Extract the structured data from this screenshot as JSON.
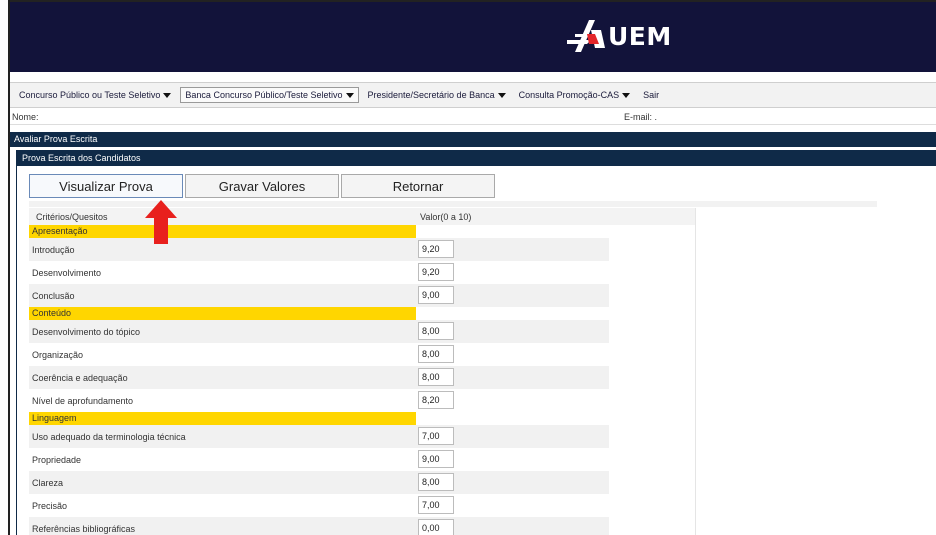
{
  "header": {
    "logo_text": "UEM",
    "logo_icon": "uem-flame-icon",
    "accent": "#e3262a",
    "bg": "#12133a"
  },
  "menu": {
    "items": [
      {
        "label": "Concurso Público ou Teste Seletivo",
        "has_caret": true
      },
      {
        "label": "Banca Concurso Público/Teste Seletivo",
        "has_caret": true
      },
      {
        "label": "Presidente/Secretário de Banca",
        "has_caret": true
      },
      {
        "label": "Consulta Promoção-CAS",
        "has_caret": true
      },
      {
        "label": "Sair",
        "has_caret": false
      }
    ]
  },
  "info": {
    "nome_label": "Nome:",
    "email_label": "E-mail: ."
  },
  "page": {
    "title": "Avaliar Prova Escrita"
  },
  "panel": {
    "title": "Prova Escrita dos Candidatos",
    "buttons": {
      "view": "Visualizar Prova",
      "save": "Gravar Valores",
      "back": "Retornar"
    }
  },
  "grid": {
    "col_criteria": "Critérios/Quesitos",
    "col_value": "Valor(0 a 10)",
    "sections": [
      {
        "name": "Apresentação",
        "rows": [
          {
            "label": "Introdução",
            "value": "9,20"
          },
          {
            "label": "Desenvolvimento",
            "value": "9,20"
          },
          {
            "label": "Conclusão",
            "value": "9,00"
          }
        ]
      },
      {
        "name": "Conteúdo",
        "rows": [
          {
            "label": "Desenvolvimento do tópico",
            "value": "8,00"
          },
          {
            "label": "Organização",
            "value": "8,00"
          },
          {
            "label": "Coerência e adequação",
            "value": "8,00"
          },
          {
            "label": "Nível de aprofundamento",
            "value": "8,20"
          }
        ]
      },
      {
        "name": "Linguagem",
        "rows": [
          {
            "label": "Uso adequado da terminologia técnica",
            "value": "7,00"
          },
          {
            "label": "Propriedade",
            "value": "9,00"
          },
          {
            "label": "Clareza",
            "value": "8,00"
          },
          {
            "label": "Precisão",
            "value": "7,00"
          },
          {
            "label": "Referências bibliográficas",
            "value": "0,00"
          }
        ]
      }
    ]
  },
  "annotation": {
    "icon": "red-arrow-up-icon",
    "color": "#e8201d"
  }
}
